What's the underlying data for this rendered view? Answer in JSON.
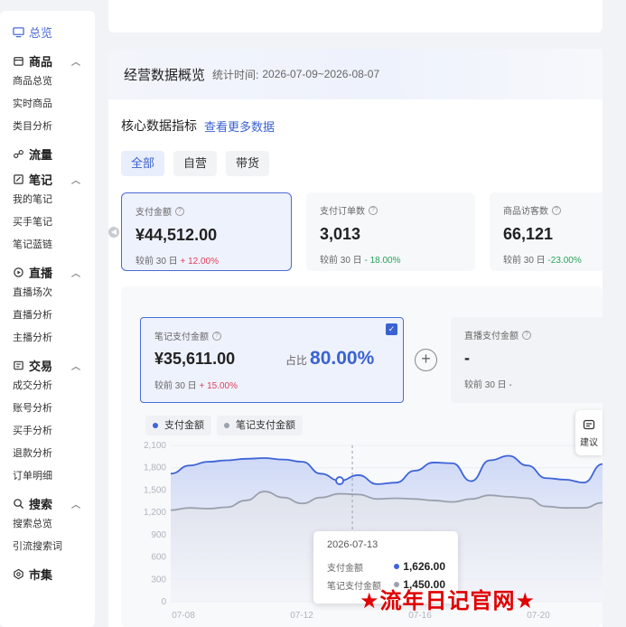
{
  "sidebar": {
    "overview": "总览",
    "groups": [
      {
        "title": "商品",
        "items": [
          "商品总览",
          "实时商品",
          "类目分析"
        ],
        "expanded": true,
        "icon": "box-icon"
      },
      {
        "title": "流量",
        "items": [],
        "expanded": false,
        "icon": "traffic-icon"
      },
      {
        "title": "笔记",
        "items": [
          "我的笔记",
          "买手笔记",
          "笔记蓝链"
        ],
        "expanded": true,
        "icon": "note-icon"
      },
      {
        "title": "直播",
        "items": [
          "直播场次",
          "直播分析",
          "主播分析"
        ],
        "expanded": true,
        "icon": "live-icon"
      },
      {
        "title": "交易",
        "items": [
          "成交分析",
          "账号分析",
          "买手分析",
          "退款分析",
          "订单明细"
        ],
        "expanded": true,
        "icon": "trade-icon"
      },
      {
        "title": "搜索",
        "items": [
          "搜索总览",
          "引流搜索词"
        ],
        "expanded": true,
        "icon": "search-icon"
      },
      {
        "title": "市集",
        "items": [],
        "expanded": false,
        "icon": "market-icon"
      }
    ]
  },
  "header": {
    "title": "经营数据概览",
    "period_label": "统计时间:",
    "period": "2026-07-09~2026-08-07"
  },
  "section": {
    "title": "核心数据指标",
    "more_link": "查看更多数据"
  },
  "tabs": [
    "全部",
    "自营",
    "带货"
  ],
  "active_tab": "全部",
  "kpis": [
    {
      "label": "支付金额",
      "value": "¥44,512.00",
      "cmp_label": "较前 30 日",
      "change": "+ 12.00%",
      "direction": "up"
    },
    {
      "label": "支付订单数",
      "value": "3,013",
      "cmp_label": "较前 30 日",
      "change": "- 18.00%",
      "direction": "down"
    },
    {
      "label": "商品访客数",
      "value": "66,121",
      "cmp_label": "较前 30 日",
      "change": "-23.00%",
      "direction": "down"
    }
  ],
  "sub_kpis": [
    {
      "label": "笔记支付金额",
      "value": "¥35,611.00",
      "ratio_label": "占比",
      "ratio": "80.00%",
      "cmp_label": "较前 30 日",
      "change": "+ 15.00%",
      "checked": true
    },
    {
      "label": "直播支付金额",
      "value": "-",
      "cmp_label": "较前 30 日",
      "change": "-"
    }
  ],
  "legend": [
    {
      "name": "支付金额",
      "color": "#3d64d8"
    },
    {
      "name": "笔记支付金额",
      "color": "#9aa0ad"
    }
  ],
  "chart_data": {
    "type": "area",
    "y_ticks": [
      "2,100",
      "1,800",
      "1,500",
      "1,200",
      "900",
      "600",
      "300",
      "0"
    ],
    "ylim": [
      0,
      2100
    ],
    "x_ticks": [
      "07-08",
      "07-12",
      "07-16",
      "07-20"
    ],
    "grid": true,
    "series": [
      {
        "name": "支付金额",
        "color": "#3d64d8",
        "values": [
          1720,
          1830,
          1880,
          1900,
          1920,
          1930,
          1910,
          1880,
          1720,
          1626,
          1700,
          1580,
          1600,
          1760,
          1870,
          1860,
          1620,
          1900,
          1960,
          1830,
          1660,
          1640,
          1600,
          1850
        ]
      },
      {
        "name": "笔记支付金额",
        "color": "#9aa0ad",
        "values": [
          1230,
          1260,
          1250,
          1270,
          1360,
          1480,
          1400,
          1320,
          1400,
          1450,
          1440,
          1380,
          1390,
          1380,
          1360,
          1340,
          1380,
          1430,
          1410,
          1390,
          1280,
          1260,
          1260,
          1330
        ]
      }
    ]
  },
  "tooltip": {
    "date": "2026-07-13",
    "rows": [
      {
        "label": "支付金额",
        "value": "1,626.00",
        "color": "#3d64d8"
      },
      {
        "label": "笔记支付金额",
        "value": "1,450.00",
        "color": "#9aa0ad"
      }
    ]
  },
  "suggest_label": "建议",
  "watermark": "★流年日记官网★"
}
